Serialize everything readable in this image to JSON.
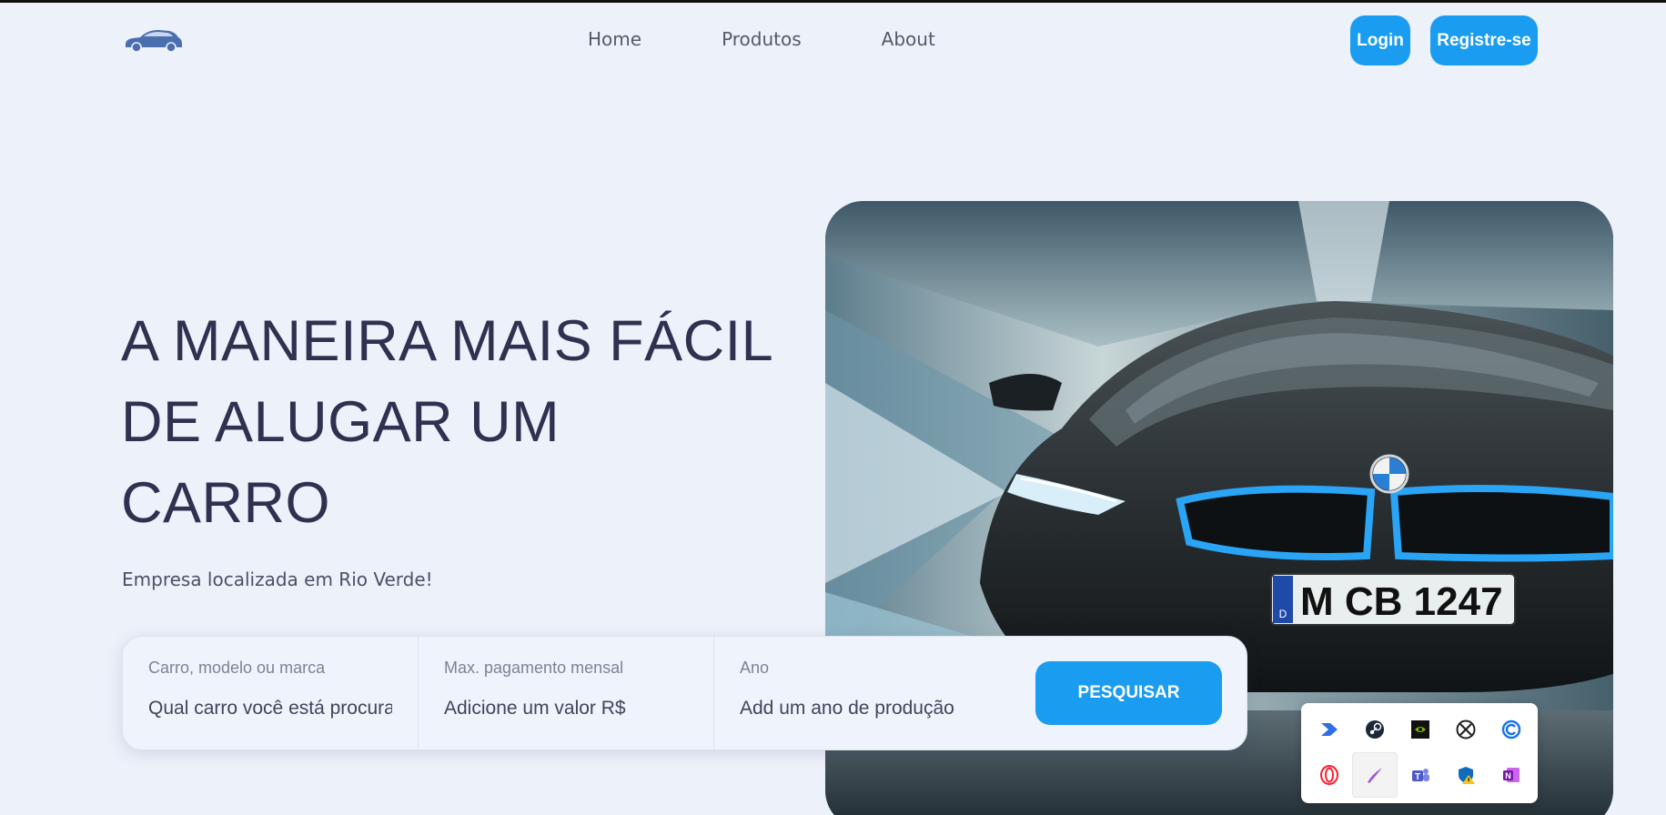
{
  "header": {
    "logo_icon": "car-logo-icon",
    "nav": [
      {
        "label": "Home"
      },
      {
        "label": "Produtos"
      },
      {
        "label": "About"
      }
    ],
    "login_label": "Login",
    "register_label": "Registre-se"
  },
  "hero": {
    "headline": "A MANEIRA MAIS FÁCIL DE ALUGAR UM CARRO",
    "subtitle": "Empresa localizada em Rio Verde!",
    "image_alt": "bmw-i8-car-image",
    "plate_text": "M CB 1247",
    "plate_country": "D"
  },
  "search": {
    "fields": [
      {
        "label": "Carro, modelo ou marca",
        "placeholder": "Qual carro você está procurando?"
      },
      {
        "label": "Max. pagamento mensal",
        "placeholder": "Adicione um valor R$"
      },
      {
        "label": "Ano",
        "placeholder": "Add um ano de produção"
      }
    ],
    "button_label": "PESQUISAR"
  },
  "tray": {
    "icons": [
      {
        "name": "power-automate-icon",
        "color": "#2f6fe6"
      },
      {
        "name": "steam-icon",
        "color": "#1b2838"
      },
      {
        "name": "nvidia-icon",
        "color": "#76b900"
      },
      {
        "name": "xbox-icon",
        "color": "#222222"
      },
      {
        "name": "ccleaner-icon",
        "color": "#1a73e8"
      },
      {
        "name": "opera-icon",
        "color": "#ff1b2d"
      },
      {
        "name": "pen-tool-icon",
        "color": "#9b59d6"
      },
      {
        "name": "teams-icon",
        "color": "#5059c9"
      },
      {
        "name": "defender-warning-icon",
        "color": "#0f6cbd"
      },
      {
        "name": "onenote-icon",
        "color": "#7719aa"
      }
    ]
  },
  "colors": {
    "accent": "#1a9cf0",
    "background": "#edf1f9",
    "headline": "#2e3150"
  }
}
